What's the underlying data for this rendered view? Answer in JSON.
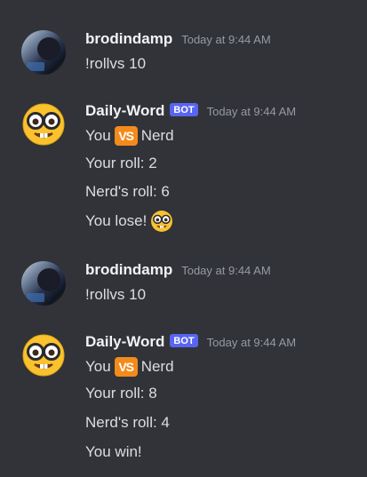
{
  "messages": [
    {
      "username": "brodindamp",
      "timestamp": "Today at 9:44 AM",
      "lines": [
        "!rollvs 10"
      ]
    },
    {
      "username": "Daily-Word",
      "bot_tag": "BOT",
      "timestamp": "Today at 9:44 AM",
      "line1_left": "You",
      "line1_badge": "VS",
      "line1_right": "Nerd",
      "lines": [
        "Your roll: 2",
        "Nerd's roll: 6",
        "You lose!"
      ]
    },
    {
      "username": "brodindamp",
      "timestamp": "Today at 9:44 AM",
      "lines": [
        "!rollvs 10"
      ]
    },
    {
      "username": "Daily-Word",
      "bot_tag": "BOT",
      "timestamp": "Today at 9:44 AM",
      "line1_left": "You",
      "line1_badge": "VS",
      "line1_right": "Nerd",
      "lines": [
        "Your roll: 8",
        "Nerd's roll: 4",
        "You win!"
      ]
    }
  ],
  "colors": {
    "background": "#313338",
    "bot_tag": "#5865f2",
    "vs_badge": "#f38b1c"
  },
  "icons": {
    "bot_avatar": "nerd-face-emoji",
    "lose_emoji": "nerd-face-emoji"
  }
}
